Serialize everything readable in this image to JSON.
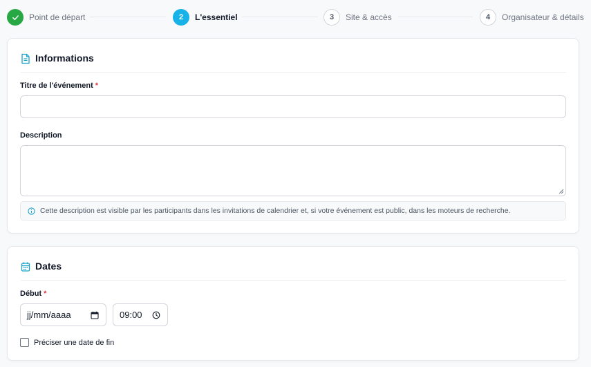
{
  "stepper": {
    "steps": [
      {
        "number": "",
        "label": "Point de départ",
        "state": "done"
      },
      {
        "number": "2",
        "label": "L'essentiel",
        "state": "active"
      },
      {
        "number": "3",
        "label": "Site & accès",
        "state": "todo"
      },
      {
        "number": "4",
        "label": "Organisateur & détails",
        "state": "todo"
      }
    ]
  },
  "info_card": {
    "title": "Informations",
    "title_field": {
      "label": "Titre de l'événement",
      "required_mark": "*",
      "value": "",
      "placeholder": ""
    },
    "description_field": {
      "label": "Description",
      "value": ""
    },
    "hint": "Cette description est visible par les participants dans les invitations de calendrier et, si votre événement est public, dans les moteurs de recherche."
  },
  "dates_card": {
    "title": "Dates",
    "start": {
      "label": "Début",
      "required_mark": "*",
      "date_value": "jj/mm/aaaa",
      "time_value": "09:00"
    },
    "end_date_checkbox": {
      "label": "Préciser une date de fin",
      "checked": false
    }
  },
  "colors": {
    "done": "#28a745",
    "active": "#17b2e8",
    "accent_icon": "#17a2c8",
    "required": "#dc3545"
  },
  "icons": {
    "step_done": "check-icon",
    "info_header": "document-icon",
    "dates_header": "calendar-icon",
    "hint": "info-circle-icon",
    "date_picker": "calendar-icon",
    "time_picker": "clock-icon"
  }
}
